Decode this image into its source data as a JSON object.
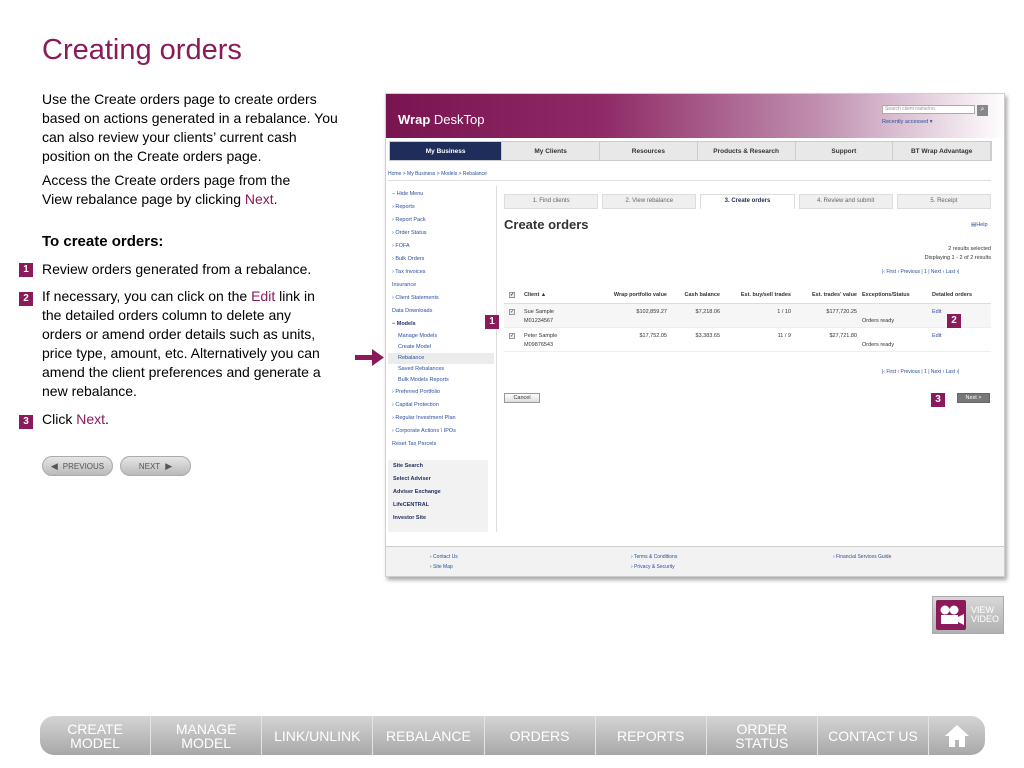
{
  "page": {
    "title": "Creating orders",
    "intro_p1": "Use the Create orders page to create orders based on actions generated in a rebalance. You can also review your clients’ current cash position on the Create orders page.",
    "intro_p2_before": "Access the Create orders page from the View rebalance page by clicking ",
    "intro_p2_link": "Next",
    "intro_p2_after": ".",
    "subheading": "To create orders:",
    "step1_marker": "1",
    "step1": "Review orders generated from a rebalance.",
    "step2_marker": "2",
    "step2_before": "If necessary, you can click on the ",
    "step2_link": "Edit",
    "step2_after": " link in the detailed orders column to delete any orders or amend order details such as units, price type, amount, etc. Alternatively you can amend the client preferences and generate a new rebalance.",
    "step3_marker": "3",
    "step3_before": "Click ",
    "step3_link": "Next",
    "step3_after": ".",
    "prev_label": "PREVIOUS",
    "next_label": "NEXT",
    "accent_color": "#8a1a5a"
  },
  "screenshot": {
    "logo_bold": "Wrap",
    "logo_rest": " DeskTop",
    "search_placeholder": "Search client name/no.",
    "recently_accessed": "Recently accessed ▾",
    "nav": [
      "My Business",
      "My Clients",
      "Resources",
      "Products & Research",
      "Support",
      "BT Wrap Advantage"
    ],
    "breadcrumb": "Home  >  My Business  >  Models  >  Rebalance",
    "sidebar": [
      {
        "label": "− Hide Menu",
        "type": "top"
      },
      {
        "label": "› Reports",
        "type": "top"
      },
      {
        "label": "› Report Pack",
        "type": "top"
      },
      {
        "label": "› Order Status",
        "type": "top"
      },
      {
        "label": "› FOFA",
        "type": "top"
      },
      {
        "label": "› Bulk Orders",
        "type": "top"
      },
      {
        "label": "› Tax Invoices",
        "type": "top"
      },
      {
        "label": "Insurance",
        "type": "top"
      },
      {
        "label": "› Client Statements",
        "type": "top"
      },
      {
        "label": "Data Downloads",
        "type": "top"
      },
      {
        "label": "− Models",
        "type": "bold"
      },
      {
        "label": "Manage Models",
        "type": "sub"
      },
      {
        "label": "Create Model",
        "type": "sub"
      },
      {
        "label": "Rebalance",
        "type": "subhl"
      },
      {
        "label": "Saved Rebalances",
        "type": "sub"
      },
      {
        "label": "Bulk Models Reports",
        "type": "sub"
      },
      {
        "label": "› Preferred Portfolio",
        "type": "top"
      },
      {
        "label": "› Capital Protection",
        "type": "top"
      },
      {
        "label": "› Regular Investment Plan",
        "type": "top"
      },
      {
        "label": "› Corporate Actions \\ IPOs",
        "type": "top"
      },
      {
        "label": "Reset Tax Parcels",
        "type": "top"
      }
    ],
    "sidebox": [
      "Site Search",
      "Select Adviser",
      "Adviser Exchange",
      "LifeCENTRAL",
      "Investor Site"
    ],
    "steps": [
      "1. Find clients",
      "2. View rebalance",
      "3. Create orders",
      "4. Review and submit",
      "5. Receipt"
    ],
    "active_step": 2,
    "heading": "Create orders",
    "help": "Help",
    "results_selected": "2 results selected",
    "displaying": "Displaying 1 - 2 of 2 results",
    "pager": "|‹ First   ‹ Previous  |  1  |  Next ›   Last ›|",
    "columns": [
      "Client  ▲",
      "Wrap portfolio value",
      "Cash balance",
      "Est. buy/sell trades",
      "Est. trades' value",
      "Exceptions/Status",
      "Detailed orders"
    ],
    "rows": [
      {
        "name": "Sue Sample",
        "id": "M01234567",
        "portfolio": "$102,859.27",
        "cash": "$7,218.06",
        "trades": "1 / 10",
        "trades_value": "$177,720.25",
        "status": "Orders ready",
        "action": "Edit"
      },
      {
        "name": "Peter Sample",
        "id": "M09876543",
        "portfolio": "$17,752.05",
        "cash": "$3,383.65",
        "trades": "11 / 9",
        "trades_value": "$27,721.80",
        "status": "Orders ready",
        "action": "Edit"
      }
    ],
    "cancel": "Cancel",
    "next": "Next >",
    "callout1": "1",
    "callout2": "2",
    "callout3": "3",
    "footer_col1": [
      "› Contact Us",
      "› Site Map"
    ],
    "footer_col2": [
      "› Terms & Conditions",
      "› Privacy & Security"
    ],
    "footer_col3": [
      "› Financial Services Guide"
    ]
  },
  "video": {
    "label1": "VIEW",
    "label2": "VIDEO"
  },
  "bottom_nav": [
    {
      "line1": "CREATE",
      "line2": "MODEL"
    },
    {
      "line1": "MANAGE",
      "line2": "MODEL"
    },
    {
      "line1": "LINK/UNLINK",
      "line2": ""
    },
    {
      "line1": "REBALANCE",
      "line2": ""
    },
    {
      "line1": "ORDERS",
      "line2": ""
    },
    {
      "line1": "REPORTS",
      "line2": ""
    },
    {
      "line1": "ORDER",
      "line2": "STATUS"
    },
    {
      "line1": "CONTACT US",
      "line2": ""
    }
  ]
}
